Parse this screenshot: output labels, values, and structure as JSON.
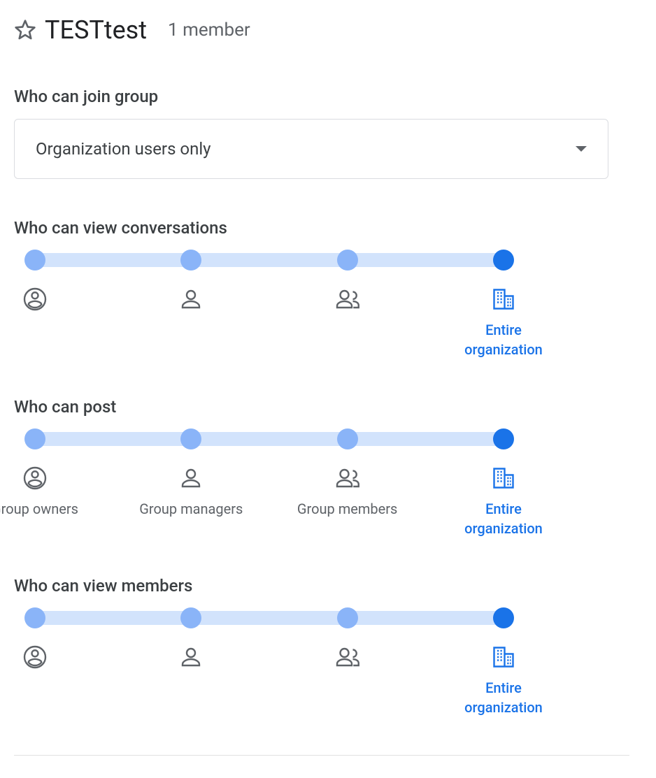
{
  "header": {
    "title": "TESTtest",
    "member_count": "1 member"
  },
  "who_can_join": {
    "heading": "Who can join group",
    "selected": "Organization users only"
  },
  "sliders": {
    "stops": [
      {
        "id": "owners",
        "label": "Group owners",
        "icon": "account-circle"
      },
      {
        "id": "managers",
        "label": "Group managers",
        "icon": "person"
      },
      {
        "id": "members",
        "label": "Group members",
        "icon": "people"
      },
      {
        "id": "org",
        "label": "Entire organization",
        "icon": "org-building"
      }
    ],
    "sections": [
      {
        "id": "view_conversations",
        "heading": "Who can view conversations",
        "selected": "org",
        "show_inactive_labels": false
      },
      {
        "id": "post",
        "heading": "Who can post",
        "selected": "org",
        "show_inactive_labels": true
      },
      {
        "id": "view_members",
        "heading": "Who can view members",
        "selected": "org",
        "show_inactive_labels": false
      }
    ]
  },
  "colors": {
    "accent": "#1a73e8",
    "track": "#d2e3fc",
    "dot": "#8ab4f8",
    "muted": "#5f6368"
  }
}
